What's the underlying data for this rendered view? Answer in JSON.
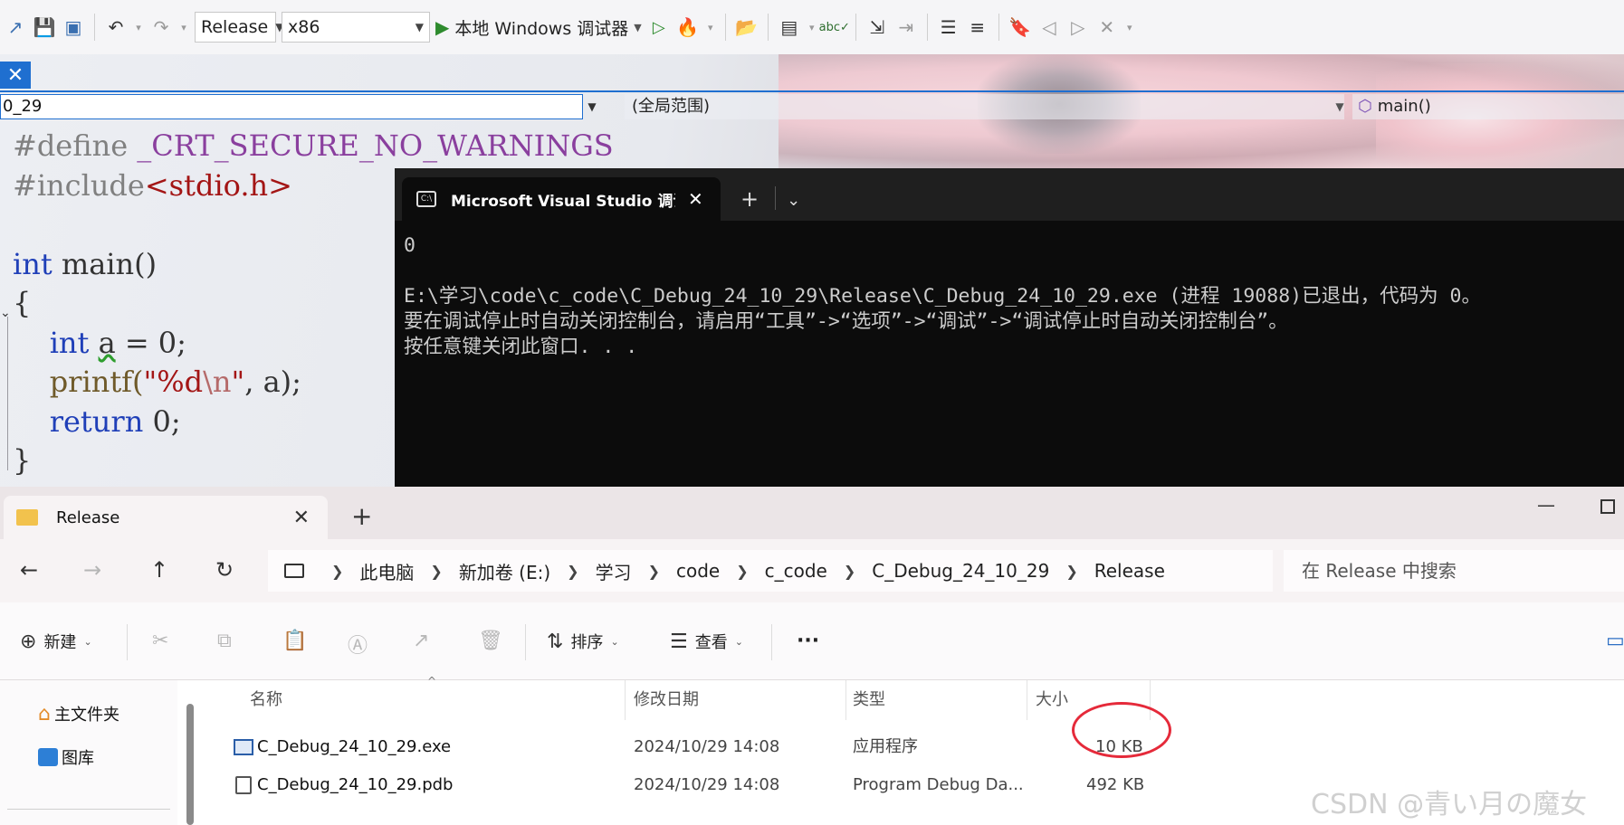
{
  "vs": {
    "config": "Release",
    "platform": "x86",
    "run_label": "本地 Windows 调试器"
  },
  "editor": {
    "file_combo": "0_29",
    "scope_combo": "(全局范围)",
    "member_combo": "main()",
    "code": {
      "l1_kw": "#define",
      "l1_macro": " _CRT_SECURE_NO_WARNINGS",
      "l2_kw": "#include",
      "l2_file": "<stdio.h>",
      "l4_type": "int",
      "l4_rest": " main()",
      "l5": "{",
      "l6_type": "int",
      "l6_var": "a",
      "l6_rest": " = 0;",
      "l7_fn": "printf(",
      "l7_str": "\"%d",
      "l7_esc": "\\n",
      "l7_str2": "\"",
      "l7_rest": ", a);",
      "l8_kw": "return",
      "l8_rest": " 0;",
      "l9": "}"
    }
  },
  "terminal": {
    "tab_title": "Microsoft Visual Studio 调试控制台",
    "icon_text": "C:\\",
    "lines": [
      "0",
      "",
      "E:\\学习\\code\\c_code\\C_Debug_24_10_29\\Release\\C_Debug_24_10_29.exe (进程 19088)已退出，代码为 0。",
      "要在调试停止时自动关闭控制台，请启用“工具”->“选项”->“调试”->“调试停止时自动关闭控制台”。",
      "按任意键关闭此窗口. . ."
    ]
  },
  "explorer": {
    "tab_title": "Release",
    "breadcrumbs": [
      "此电脑",
      "新加卷 (E:)",
      "学习",
      "code",
      "c_code",
      "C_Debug_24_10_29",
      "Release"
    ],
    "search_placeholder": "在 Release 中搜索",
    "commands": {
      "new": "新建",
      "sort": "排序",
      "view": "查看",
      "more": "···"
    },
    "sidebar": [
      "主文件夹",
      "图库"
    ],
    "columns": [
      "名称",
      "修改日期",
      "类型",
      "大小"
    ],
    "files": [
      {
        "name": "C_Debug_24_10_29.exe",
        "date": "2024/10/29 14:08",
        "type": "应用程序",
        "size": "10 KB"
      },
      {
        "name": "C_Debug_24_10_29.pdb",
        "date": "2024/10/29 14:08",
        "type": "Program Debug Da...",
        "size": "492 KB"
      }
    ]
  },
  "watermark": "CSDN @青い月の魔女",
  "colors": {
    "accent": "#1f6fd0",
    "highlight_circle": "#e52a3a",
    "terminal_bg": "#0c0c0c"
  }
}
